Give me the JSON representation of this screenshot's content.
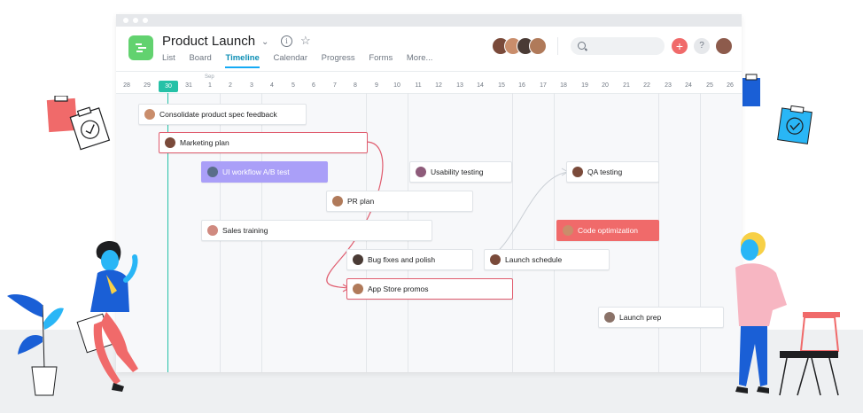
{
  "project": {
    "title": "Product Launch",
    "tabs": [
      {
        "label": "List"
      },
      {
        "label": "Board"
      },
      {
        "label": "Timeline"
      },
      {
        "label": "Calendar"
      },
      {
        "label": "Progress"
      },
      {
        "label": "Forms"
      },
      {
        "label": "More..."
      }
    ],
    "active_tab": "Timeline"
  },
  "colors": {
    "accent": "#14aaf5",
    "app_icon": "#62d26f",
    "today": "#25c1a7",
    "add": "#f06a6a",
    "purple_task": "#aa9ff8",
    "red_task": "#f06a6a",
    "dependency": "#e05c6e"
  },
  "icons": [
    "project-icon",
    "chevron-down-icon",
    "info-icon",
    "star-icon",
    "search-icon",
    "plus-icon",
    "help-icon"
  ],
  "timeline": {
    "month_label": "Sep",
    "today": "30",
    "days": [
      "28",
      "29",
      "30",
      "31",
      "1",
      "2",
      "3",
      "4",
      "5",
      "6",
      "7",
      "8",
      "9",
      "10",
      "11",
      "12",
      "13",
      "14",
      "15",
      "16",
      "17",
      "18",
      "19",
      "20",
      "21",
      "22",
      "23",
      "24",
      "25",
      "26"
    ],
    "tasks": [
      {
        "name": "Consolidate product spec feedback"
      },
      {
        "name": "Marketing plan"
      },
      {
        "name": "UI workflow A/B test"
      },
      {
        "name": "Usability testing"
      },
      {
        "name": "QA testing"
      },
      {
        "name": "PR plan"
      },
      {
        "name": "Sales training"
      },
      {
        "name": "Code optimization"
      },
      {
        "name": "Bug fixes and polish"
      },
      {
        "name": "Launch schedule"
      },
      {
        "name": "App Store promos"
      },
      {
        "name": "Launch prep"
      }
    ]
  }
}
